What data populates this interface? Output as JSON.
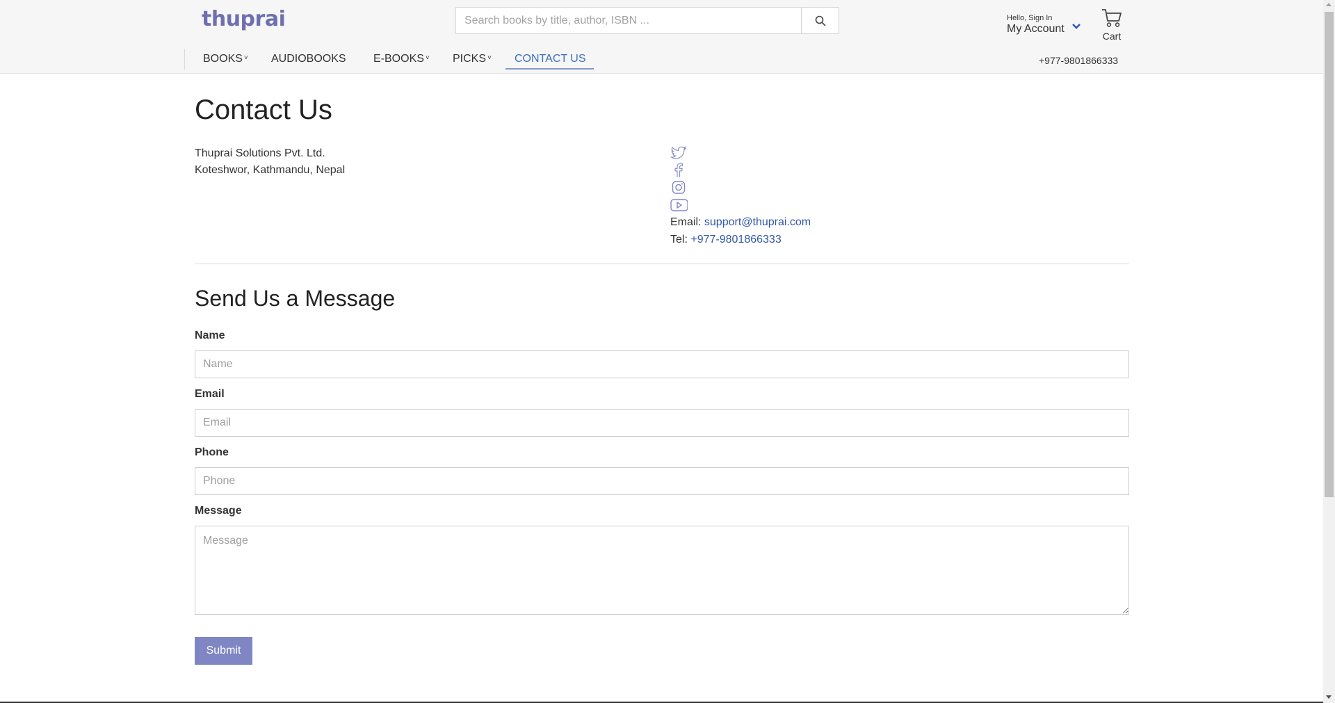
{
  "header": {
    "logo": "thuprai",
    "search": {
      "placeholder": "Search books by title, author, ISBN ...",
      "icon": "search-icon"
    },
    "account": {
      "greeting": "Hello, Sign In",
      "label": "My Account"
    },
    "cart": {
      "label": "Cart",
      "icon": "cart-icon"
    },
    "phone": "+977-9801866333"
  },
  "nav": {
    "items": [
      {
        "label": "BOOKS",
        "caret": "˅"
      },
      {
        "label": "AUDIOBOOKS"
      },
      {
        "label": "E-BOOKS",
        "caret": "˅"
      },
      {
        "label": "PICKS",
        "caret": "˅"
      },
      {
        "label": "CONTACT US",
        "active": true
      }
    ]
  },
  "contact": {
    "title": "Contact Us",
    "company": "Thuprai Solutions Pvt. Ltd.",
    "address": "Koteshwor, Kathmandu, Nepal",
    "social": [
      "twitter-icon",
      "facebook-icon",
      "instagram-icon",
      "youtube-icon"
    ],
    "email_label": "Email:",
    "email": "support@thuprai.com",
    "tel_label": "Tel:",
    "tel": "+977-9801866333"
  },
  "form": {
    "title": "Send Us a Message",
    "name_label": "Name",
    "name_placeholder": "Name",
    "email_label": "Email",
    "email_placeholder": "Email",
    "phone_label": "Phone",
    "phone_placeholder": "Phone",
    "message_label": "Message",
    "message_placeholder": "Message",
    "submit": "Submit"
  },
  "colors": {
    "accent": "#8086c4",
    "link": "#3157a8",
    "logo": "#6f6fb0",
    "header_bg": "#f6f6f6"
  }
}
